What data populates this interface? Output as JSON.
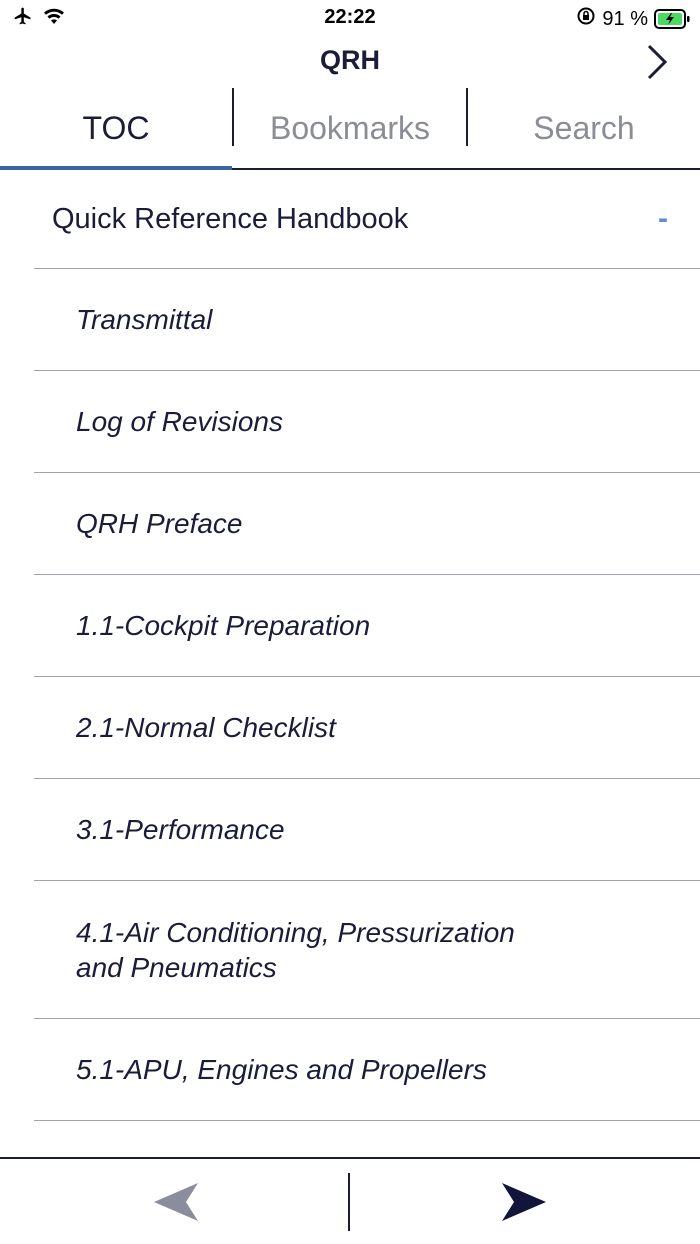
{
  "status_bar": {
    "time": "22:22",
    "battery_percent": "91 %",
    "icons": [
      "airplane-mode-icon",
      "wifi-icon",
      "orientation-lock-icon",
      "battery-charging-icon"
    ]
  },
  "header": {
    "title": "QRH",
    "next_icon": "chevron-right-icon"
  },
  "tabs": [
    {
      "label": "TOC",
      "active": true
    },
    {
      "label": "Bookmarks",
      "active": false
    },
    {
      "label": "Search",
      "active": false
    }
  ],
  "toc": {
    "root_label": "Quick Reference Handbook",
    "collapse_symbol": "-",
    "items": [
      "Transmittal",
      "Log of Revisions",
      "QRH Preface",
      "1.1-Cockpit Preparation",
      "2.1-Normal Checklist",
      "3.1-Performance",
      "4.1-Air Conditioning, Pressurization and Pneumatics",
      "5.1-APU, Engines and Propellers"
    ]
  },
  "bottom_bar": {
    "prev_icon": "arrow-left-icon",
    "next_icon": "arrow-right-icon"
  },
  "colors": {
    "text": "#1a1c3a",
    "inactive_tab": "#8a8d93",
    "accent": "#3b64a8",
    "collapse": "#5b8fd0",
    "battery": "#4cd964",
    "disabled_arrow": "#8a8d9c"
  }
}
